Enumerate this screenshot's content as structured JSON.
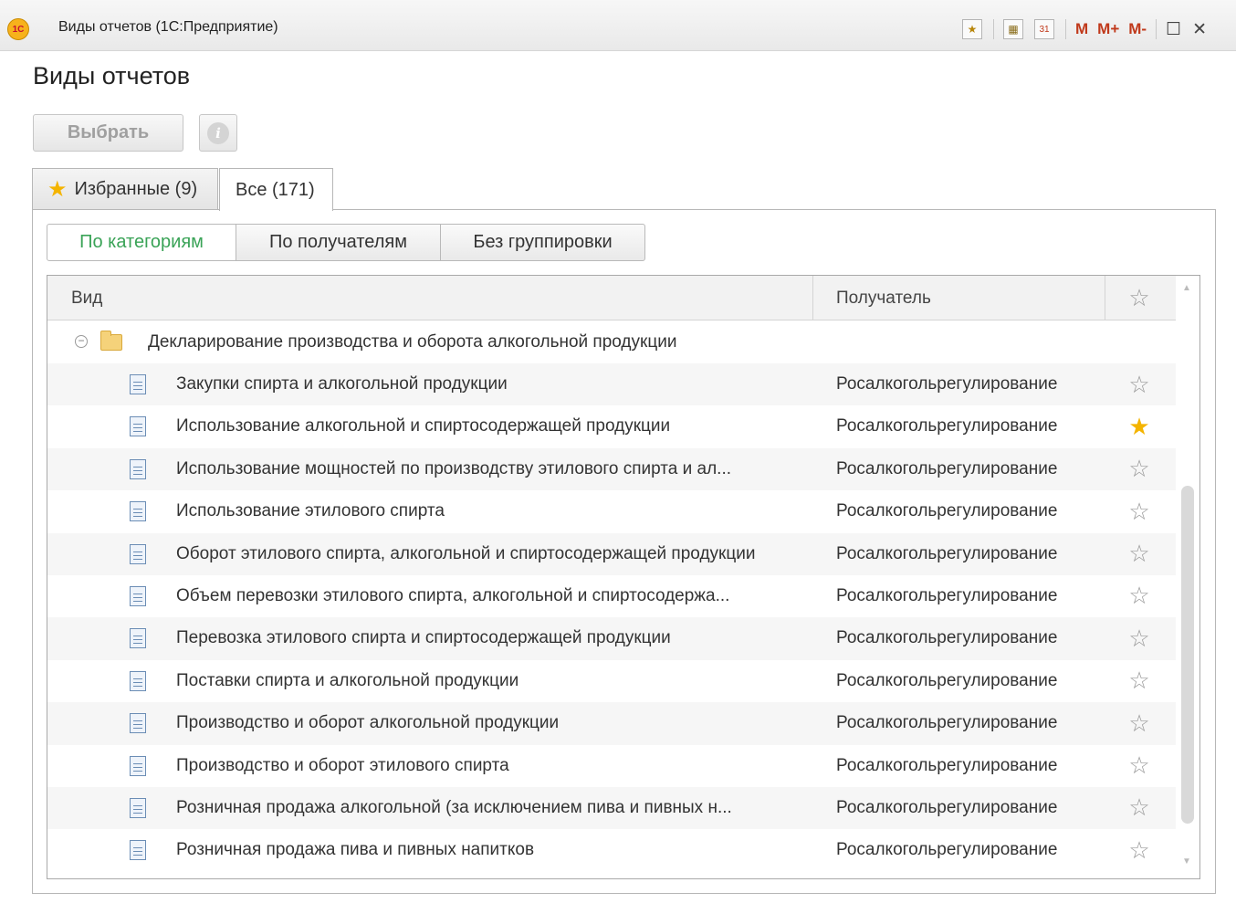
{
  "window": {
    "title": "Виды отчетов  (1С:Предприятие)",
    "logo_text": "1С",
    "toolbar": {
      "m_label": "M",
      "mplus_label": "M+",
      "mminus_label": "M-",
      "calendar_label": "31"
    }
  },
  "page": {
    "title": "Виды отчетов",
    "select_button": "Выбрать",
    "info_button_glyph": "i"
  },
  "tabs": [
    {
      "label": "Избранные (9)",
      "active": false
    },
    {
      "label": "Все (171)",
      "active": true
    }
  ],
  "grouping": {
    "options": [
      "По категориям",
      "По получателям",
      "Без группировки"
    ],
    "selected": "По категориям"
  },
  "table": {
    "columns": {
      "kind": "Вид",
      "recipient": "Получатель"
    },
    "group": "Декларирование производства и оборота алкогольной продукции",
    "rows": [
      {
        "name": "Закупки спирта и алкогольной продукции",
        "recipient": "Росалкогольрегулирование",
        "favorite": false
      },
      {
        "name": "Использование алкогольной и спиртосодержащей продукции",
        "recipient": "Росалкогольрегулирование",
        "favorite": true
      },
      {
        "name": "Использование мощностей по производству этилового спирта и ал...",
        "recipient": "Росалкогольрегулирование",
        "favorite": false
      },
      {
        "name": "Использование этилового спирта",
        "recipient": "Росалкогольрегулирование",
        "favorite": false
      },
      {
        "name": "Оборот этилового спирта, алкогольной и спиртосодержащей продукции",
        "recipient": "Росалкогольрегулирование",
        "favorite": false
      },
      {
        "name": "Объем перевозки этилового спирта, алкогольной и спиртосодержа...",
        "recipient": "Росалкогольрегулирование",
        "favorite": false
      },
      {
        "name": "Перевозка этилового спирта и спиртосодержащей продукции",
        "recipient": "Росалкогольрегулирование",
        "favorite": false
      },
      {
        "name": "Поставки спирта и алкогольной продукции",
        "recipient": "Росалкогольрегулирование",
        "favorite": false
      },
      {
        "name": "Производство и оборот алкогольной продукции",
        "recipient": "Росалкогольрегулирование",
        "favorite": false
      },
      {
        "name": "Производство и оборот этилового спирта",
        "recipient": "Росалкогольрегулирование",
        "favorite": false
      },
      {
        "name": "Розничная продажа алкогольной (за исключением пива и пивных н...",
        "recipient": "Росалкогольрегулирование",
        "favorite": false
      },
      {
        "name": "Розничная продажа пива и пивных напитков",
        "recipient": "Росалкогольрегулирование",
        "favorite": false
      }
    ]
  },
  "colors": {
    "accent_green": "#3aa357",
    "favorite_star": "#f4b400",
    "star_outline": "#9a9a9a"
  }
}
